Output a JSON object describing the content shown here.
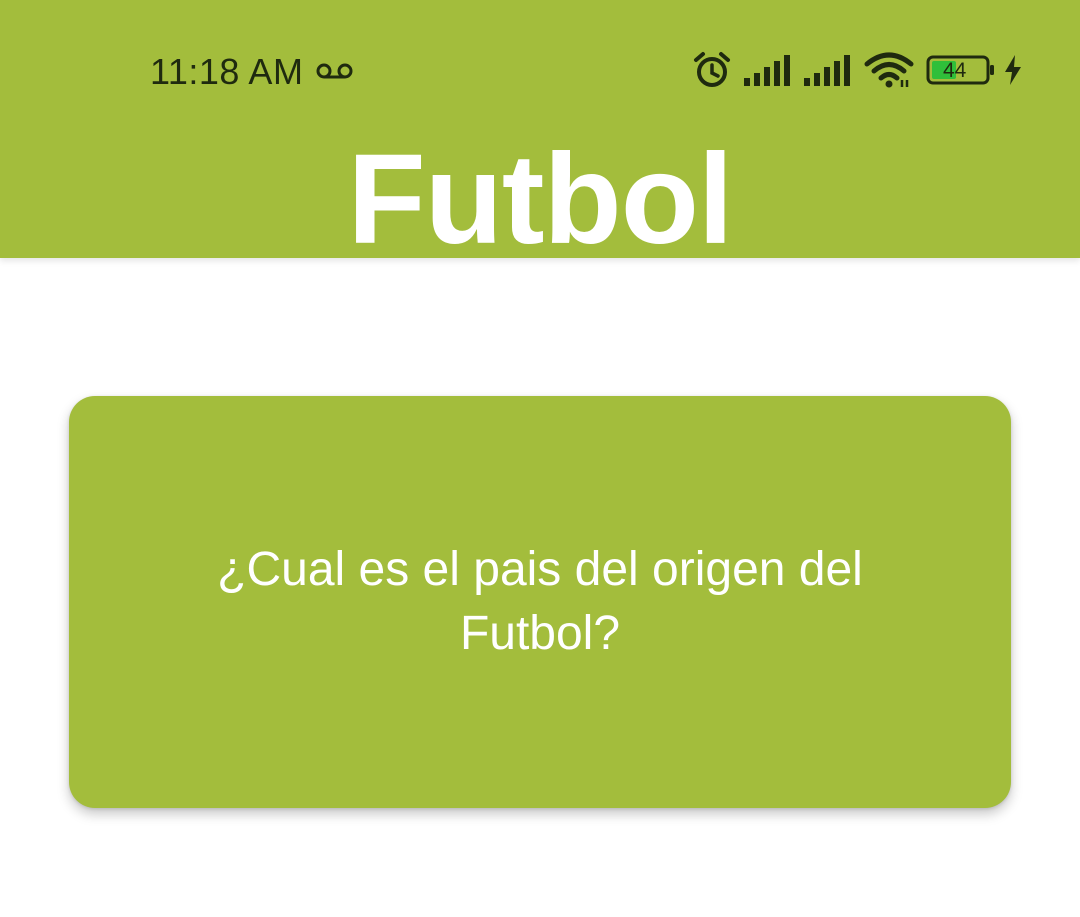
{
  "status_bar": {
    "time": "11:18 AM",
    "battery_level": "44",
    "icons": [
      "voicemail-icon",
      "alarm-icon",
      "signal-icon",
      "signal-icon",
      "wifi-icon",
      "battery-icon",
      "charging-bolt-icon"
    ]
  },
  "header": {
    "title": "Futbol",
    "color": "#a3bd3c"
  },
  "card": {
    "question": "¿Cual es el pais del origen del Futbol?",
    "color": "#a3bd3c"
  }
}
